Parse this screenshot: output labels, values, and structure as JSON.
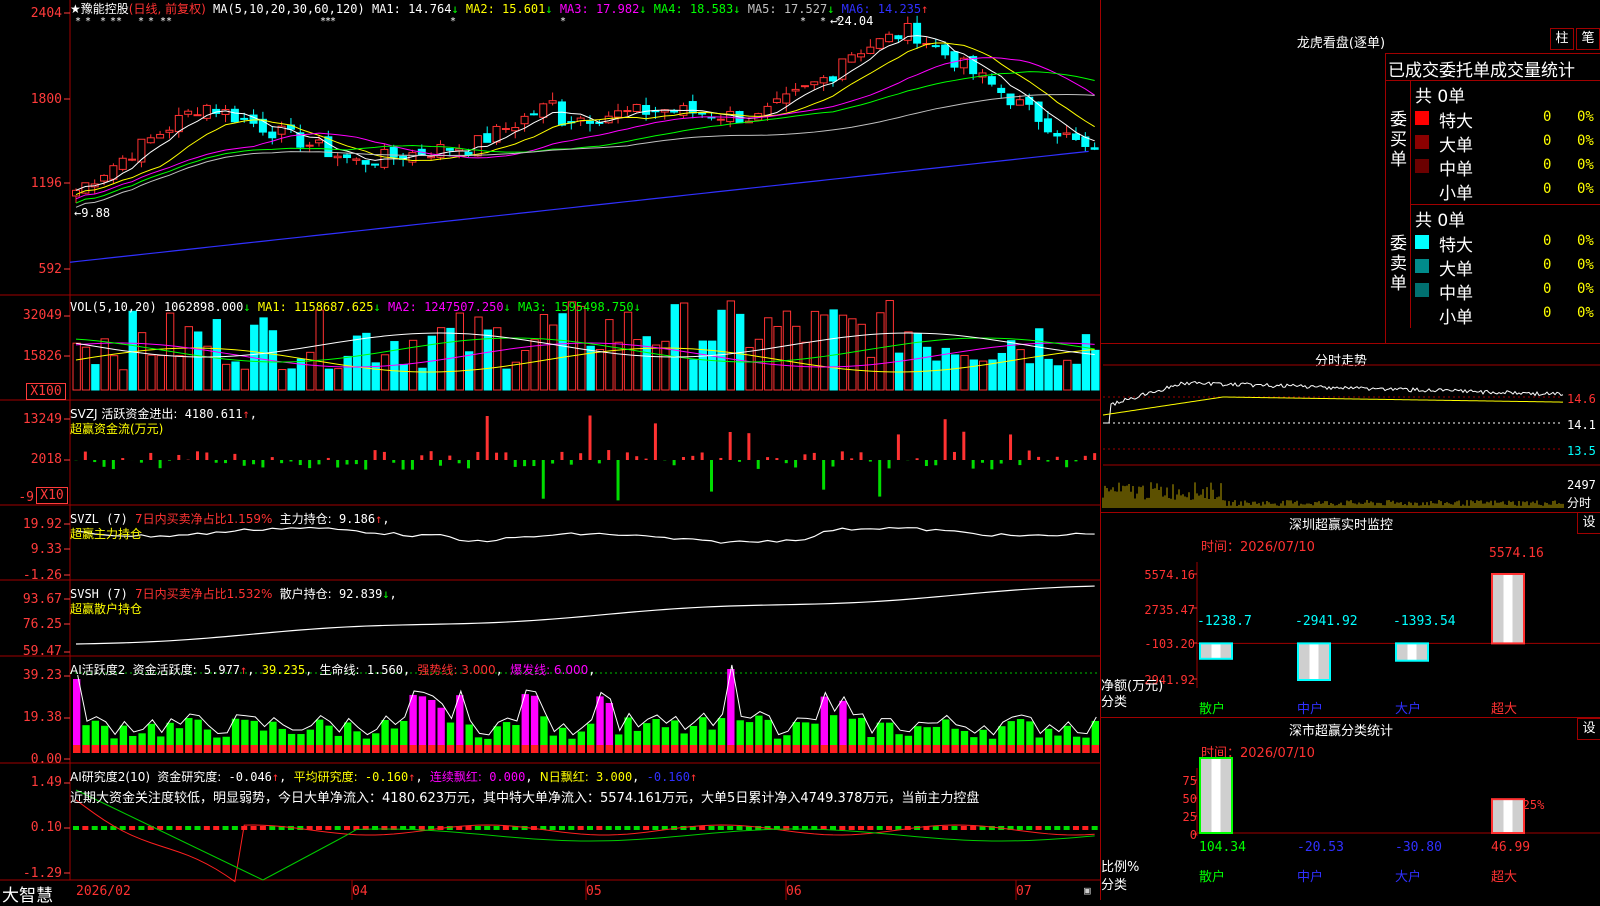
{
  "app_name": "大智慧",
  "stock": {
    "name": "★豫能控股",
    "period": "(日线, 前复权)",
    "ma_label": "MA(5,10,20,30,60,120)",
    "ma": [
      {
        "label": "MA1:",
        "value": "14.764",
        "arrow": "↓",
        "color": "#ffffff"
      },
      {
        "label": "MA2:",
        "value": "15.601",
        "arrow": "↓",
        "color": "#ffff00"
      },
      {
        "label": "MA3:",
        "value": "17.982",
        "arrow": "↓",
        "color": "#ff00ff"
      },
      {
        "label": "MA4:",
        "value": "18.583",
        "arrow": "↓",
        "color": "#00ff00"
      },
      {
        "label": "MA5:",
        "value": "17.527",
        "arrow": "↓",
        "color": "#c0c0c0"
      },
      {
        "label": "MA6:",
        "value": "14.235",
        "arrow": "↑",
        "color": "#3030ff"
      }
    ],
    "max_marker": "←24.04",
    "min_marker": "←9.88"
  },
  "price_axis": [
    "2404",
    "1800",
    "1196",
    "592"
  ],
  "volume": {
    "header": "VOL(5,10,20)",
    "value": "1062898.000",
    "arrow": "↓",
    "ma": [
      {
        "label": "MA1:",
        "value": "1158687.625",
        "arrow": "↓",
        "color": "#ffff00"
      },
      {
        "label": "MA2:",
        "value": "1247507.250",
        "arrow": "↓",
        "color": "#ff00ff"
      },
      {
        "label": "MA3:",
        "value": "1595498.750",
        "arrow": "↓",
        "color": "#00ff00"
      }
    ],
    "axis": [
      "32049",
      "15826",
      "X100"
    ]
  },
  "svzj": {
    "header": "SVZJ  活跃资金进出:",
    "value": "4180.611",
    "arrow": "↑",
    "tail": ",",
    "sub": "超赢资金流(万元)",
    "axis": [
      "13249",
      "2018",
      "-9",
      "X10"
    ]
  },
  "svzl": {
    "header": "SVZL (7)",
    "red_text": "7日内买卖净占比1.159%",
    "label2": "主力持仓:",
    "value": "9.186",
    "arrow": "↑",
    "tail": ",",
    "sub": "超赢主力持仓",
    "axis": [
      "19.92",
      "9.33",
      "-1.26"
    ]
  },
  "svsh": {
    "header": "SVSH (7)",
    "red_text": "7日内买卖净占比1.532%",
    "label2": "散户持仓:",
    "value": "92.839",
    "arrow": "↓",
    "tail": ",",
    "sub": "超赢散户持仓",
    "axis": [
      "93.67",
      "76.25",
      "59.47"
    ]
  },
  "ai_active": {
    "header": "AI活跃度2",
    "label1": "资金活跃度:",
    "v1": "5.977",
    "a1": "↑",
    "v2": "39.235",
    "label3": "生命线:",
    "v3": "1.560",
    "strong": "强势线: 3.000",
    "burst": "爆发线: 6.000",
    "axis": [
      "39.23",
      "19.38",
      "0.00"
    ]
  },
  "ai_research": {
    "header": "AI研究度2(10)",
    "label1": "资金研究度:",
    "v1": "-0.046",
    "a1": "↑",
    "label2": "平均研究度:",
    "v2": "-0.160",
    "a2": "↑",
    "label3": "连续飘红:",
    "v3": "0.000",
    "label4": "N日飘红:",
    "v4": "3.000",
    "v5": "-0.160",
    "a5": "↑",
    "summary": "近期大资金关注度较低，明显弱势，今日大单净流入：4180.623万元，其中特大单净流入：5574.161万元，大单5日累计净入4749.378万元，当前主力控盘",
    "axis": [
      "1.49",
      "0.10",
      "-1.29"
    ]
  },
  "date_axis": [
    "2026/02",
    "04",
    "05",
    "06",
    "07"
  ],
  "right": {
    "dragon_title": "龙虎看盘(逐单)",
    "btn_zhu": "柱",
    "btn_bi": "笔",
    "table_title": "已成交委托单成交量统计",
    "buy": {
      "side_label": "委买单",
      "total": "共 0单",
      "rows": [
        {
          "name": "特大",
          "count": "0",
          "pct": "0%",
          "color": "#ff0000"
        },
        {
          "name": "大单",
          "count": "0",
          "pct": "0%",
          "color": "#8b0000"
        },
        {
          "name": "中单",
          "count": "0",
          "pct": "0%",
          "color": "#6b0000"
        },
        {
          "name": "小单",
          "count": "0",
          "pct": "0%",
          "color": ""
        }
      ]
    },
    "sell": {
      "side_label": "委卖单",
      "total": "共 0单",
      "rows": [
        {
          "name": "特大",
          "count": "0",
          "pct": "0%",
          "color": "#00ffff"
        },
        {
          "name": "大单",
          "count": "0",
          "pct": "0%",
          "color": "#008b8b"
        },
        {
          "name": "中单",
          "count": "0",
          "pct": "0%",
          "color": "#007070"
        },
        {
          "name": "小单",
          "count": "0",
          "pct": "0%",
          "color": ""
        }
      ]
    },
    "intraday": {
      "title": "分时走势",
      "axis": [
        "14.6",
        "14.1",
        "13.5"
      ],
      "vol_label": "2497",
      "vol_sub": "分时"
    },
    "monitor": {
      "title": "深圳超赢实时监控",
      "btn": "设",
      "time": "时间：2026/07/10",
      "axis": [
        "5574.16",
        "2735.47",
        "-103.20",
        "-2941.92"
      ],
      "bar_labels": [
        "-1238.7",
        "-2941.92",
        "-1393.54",
        "5574.16"
      ],
      "bar_values": [
        -1238.7,
        -2941.92,
        -1393.54,
        5574.16
      ],
      "ylabel": "净额(万元)",
      "xlabel": "分类",
      "categories": [
        "散户",
        "中户",
        "大户",
        "超大"
      ]
    },
    "classify": {
      "title": "深市超赢分类统计",
      "btn": "设",
      "time": "时间：2026/07/10",
      "axis": [
        "75",
        "50",
        "25",
        "0"
      ],
      "ylabel": "比例%",
      "xlabel": "分类",
      "top_label": "+0.25%",
      "values": [
        "104.34",
        "-20.53",
        "-30.80",
        "46.99"
      ],
      "bar_heights": [
        104.34,
        0,
        0,
        46.99
      ],
      "categories": [
        "散户",
        "中户",
        "大户",
        "超大"
      ]
    }
  },
  "colors": {
    "up": "#ff3232",
    "down": "#00ffff",
    "grid": "#a00000"
  }
}
